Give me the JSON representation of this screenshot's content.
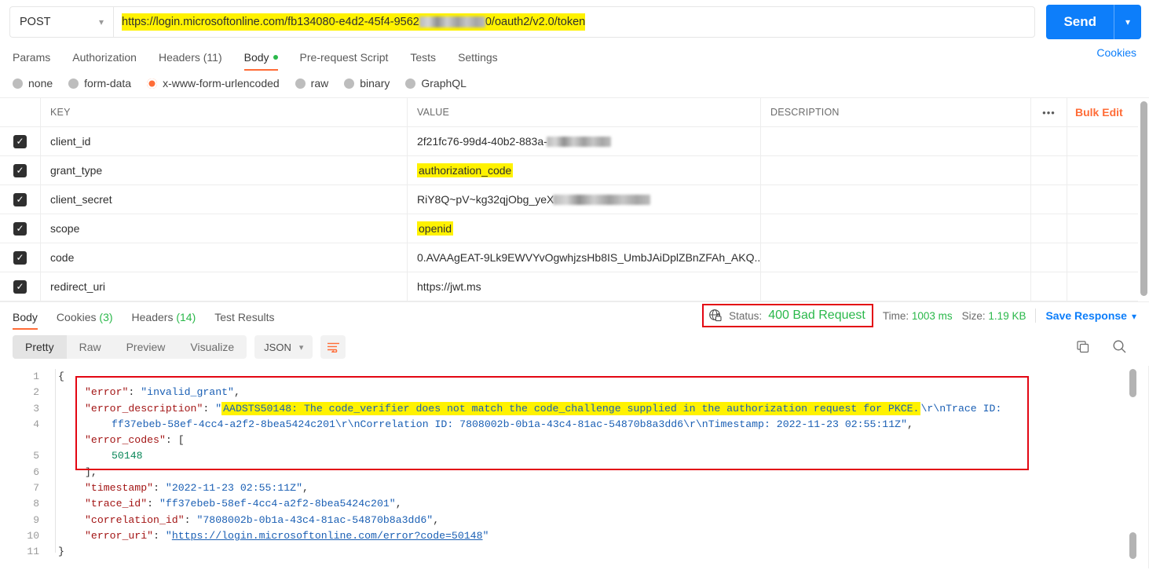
{
  "request": {
    "method": "POST",
    "method_chevron": "chevron-down-icon",
    "url_prefix": "https://login.microsoftonline.com/fb134080-e4d2-45f4-9562",
    "url_suffix": "0/oauth2/v2.0/token",
    "send_label": "Send",
    "cookies_label": "Cookies"
  },
  "request_tabs": [
    {
      "label": "Params",
      "active": false
    },
    {
      "label": "Authorization",
      "active": false
    },
    {
      "label": "Headers (11)",
      "active": false
    },
    {
      "label": "Body",
      "active": true,
      "dot": true
    },
    {
      "label": "Pre-request Script",
      "active": false
    },
    {
      "label": "Tests",
      "active": false
    },
    {
      "label": "Settings",
      "active": false
    }
  ],
  "body_types": [
    {
      "label": "none",
      "selected": false
    },
    {
      "label": "form-data",
      "selected": false
    },
    {
      "label": "x-www-form-urlencoded",
      "selected": true
    },
    {
      "label": "raw",
      "selected": false
    },
    {
      "label": "binary",
      "selected": false
    },
    {
      "label": "GraphQL",
      "selected": false
    }
  ],
  "params_table": {
    "headers": {
      "key": "KEY",
      "value": "VALUE",
      "description": "DESCRIPTION",
      "menu": "•••",
      "bulk_edit": "Bulk Edit"
    },
    "rows": [
      {
        "checked": true,
        "key": "client_id",
        "value": "2f21fc76-99d4-40b2-883a-",
        "redacted": true,
        "redact_width": 82,
        "highlight": false,
        "description": ""
      },
      {
        "checked": true,
        "key": "grant_type",
        "value": "authorization_code",
        "redacted": false,
        "highlight": true,
        "description": ""
      },
      {
        "checked": true,
        "key": "client_secret",
        "value": "RiY8Q~pV~kg32qjObg_yeX",
        "redacted": true,
        "redact_width": 124,
        "highlight": false,
        "description": ""
      },
      {
        "checked": true,
        "key": "scope",
        "value": "openid",
        "redacted": false,
        "highlight": true,
        "description": ""
      },
      {
        "checked": true,
        "key": "code",
        "value": "0.AVAAgEAT-9Lk9EWVYvOgwhjzsHb8IS_UmbJAiDplZBnZFAh_AKQ....",
        "redacted": false,
        "highlight": false,
        "description": ""
      },
      {
        "checked": true,
        "key": "redirect_uri",
        "value": "https://jwt.ms",
        "redacted": false,
        "highlight": false,
        "description": ""
      }
    ]
  },
  "response_tabs": [
    {
      "label": "Body",
      "count": "",
      "active": true
    },
    {
      "label": "Cookies",
      "count": "(3)",
      "active": false
    },
    {
      "label": "Headers",
      "count": "(14)",
      "active": false
    },
    {
      "label": "Test Results",
      "count": "",
      "active": false
    }
  ],
  "response_status": {
    "shield_icon": "globe-lock-icon",
    "status_label": "Status:",
    "status_value": "400 Bad Request",
    "time_label": "Time:",
    "time_value": "1003 ms",
    "size_label": "Size:",
    "size_value": "1.19 KB",
    "save_response": "Save Response",
    "save_chevron": "chevron-down-icon",
    "annotation_color": "#e30613"
  },
  "response_toolbar": {
    "views": [
      {
        "label": "Pretty",
        "active": true
      },
      {
        "label": "Raw",
        "active": false
      },
      {
        "label": "Preview",
        "active": false
      },
      {
        "label": "Visualize",
        "active": false
      }
    ],
    "format": "JSON",
    "format_chevron": "chevron-down-icon",
    "wrap_icon": "wrap-lines-icon",
    "copy_icon": "copy-icon",
    "search_icon": "search-icon"
  },
  "response_body": {
    "line_numbers": [
      "1",
      "2",
      "3",
      "4",
      "5",
      "6",
      "7",
      "8",
      "9",
      "10",
      "11"
    ],
    "json": {
      "error": "invalid_grant",
      "error_description_highlight": "AADSTS50148: The code_verifier does not match the code_challenge supplied in the authorization request for PKCE.",
      "error_description_rest_1": "\\r\\nTrace ID:",
      "error_description_rest_2": "ff37ebeb-58ef-4cc4-a2f2-8bea5424c201\\r\\nCorrelation ID: 7808002b-0b1a-43c4-81ac-54870b8a3dd6\\r\\nTimestamp: 2022-11-23 02:55:11Z",
      "error_codes": [
        50148
      ],
      "timestamp": "2022-11-23 02:55:11Z",
      "trace_id": "ff37ebeb-58ef-4cc4-a2f2-8bea5424c201",
      "correlation_id": "7808002b-0b1a-43c4-81ac-54870b8a3dd6",
      "error_uri": "https://login.microsoftonline.com/error?code=50148"
    },
    "keys": {
      "error": "\"error\"",
      "error_description": "\"error_description\"",
      "error_codes": "\"error_codes\"",
      "timestamp": "\"timestamp\"",
      "trace_id": "\"trace_id\"",
      "correlation_id": "\"correlation_id\"",
      "error_uri": "\"error_uri\""
    },
    "braces": {
      "open": "{",
      "close": "}",
      "arr_open": "[",
      "arr_close": "],",
      "comma": ","
    }
  }
}
